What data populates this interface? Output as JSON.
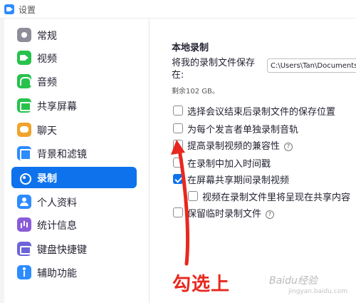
{
  "window": {
    "title": "设置"
  },
  "sidebar": {
    "items": [
      {
        "label": "常规",
        "icon": "gear-icon"
      },
      {
        "label": "视频",
        "icon": "video-camera-icon"
      },
      {
        "label": "音频",
        "icon": "headphones-icon"
      },
      {
        "label": "共享屏幕",
        "icon": "share-screen-icon"
      },
      {
        "label": "聊天",
        "icon": "chat-bubble-icon"
      },
      {
        "label": "背景和滤镜",
        "icon": "background-icon"
      },
      {
        "label": "录制",
        "icon": "record-icon",
        "selected": true
      },
      {
        "label": "个人资料",
        "icon": "profile-icon"
      },
      {
        "label": "统计信息",
        "icon": "stats-icon"
      },
      {
        "label": "键盘快捷键",
        "icon": "keyboard-icon"
      },
      {
        "label": "辅助功能",
        "icon": "accessibility-icon"
      }
    ]
  },
  "recording": {
    "section_title": "本地录制",
    "save_location_label": "将我的录制文件保存在:",
    "save_path": "C:\\Users\\Tan\\Documents\\Z",
    "remaining": "剩余102 GB。",
    "options": [
      {
        "label": "选择会议结束后录制文件的保存位置",
        "checked": false
      },
      {
        "label": "为每个发言者单独录制音轨",
        "checked": false
      },
      {
        "label": "提高录制视频的兼容性",
        "checked": false,
        "help": "?"
      },
      {
        "label": "在录制中加入时间戳",
        "checked": false
      },
      {
        "label": "在屏幕共享期间录制视频",
        "checked": true
      },
      {
        "label": "视频在录制文件里将呈现在共享内容",
        "checked": false
      },
      {
        "label": "保留临时录制文件",
        "checked": false,
        "help": "?"
      }
    ]
  },
  "annotation": {
    "text": "勾选上",
    "color": "#e8281f"
  },
  "watermark": {
    "brand": "Baidu经验",
    "url": "jingyan.baidu.com"
  },
  "colors": {
    "accent": "#0e72ed",
    "annotation": "#e8281f"
  }
}
